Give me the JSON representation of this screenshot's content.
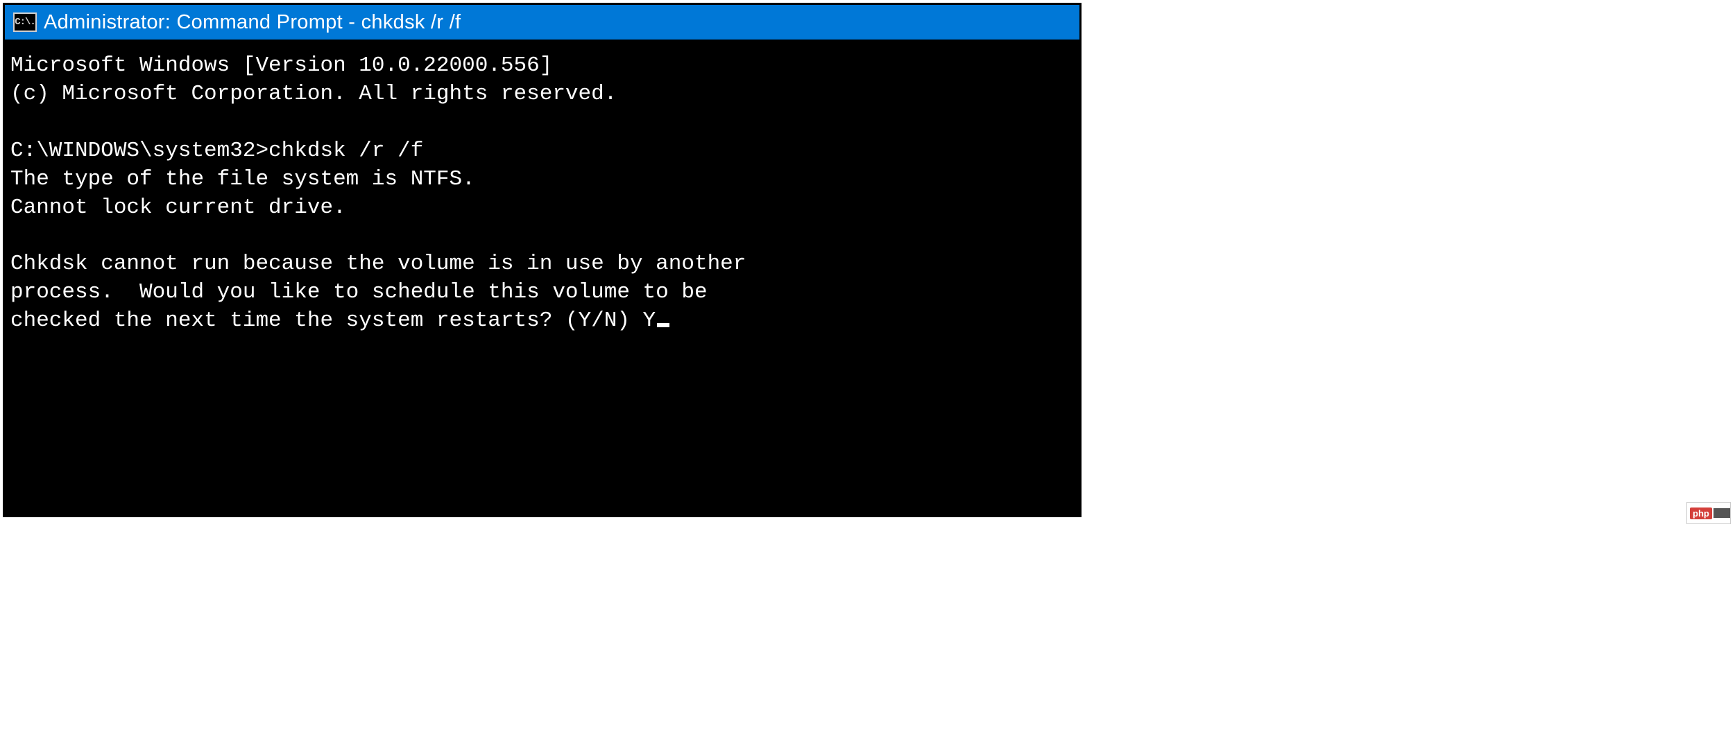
{
  "window": {
    "title": "Administrator: Command Prompt - chkdsk  /r /f",
    "icon_text": "C:\\."
  },
  "terminal": {
    "lines": [
      "Microsoft Windows [Version 10.0.22000.556]",
      "(c) Microsoft Corporation. All rights reserved.",
      "",
      "C:\\WINDOWS\\system32>chkdsk /r /f",
      "The type of the file system is NTFS.",
      "Cannot lock current drive.",
      "",
      "Chkdsk cannot run because the volume is in use by another",
      "process.  Would you like to schedule this volume to be",
      "checked the next time the system restarts? (Y/N) Y"
    ],
    "prompt": "C:\\WINDOWS\\system32>",
    "command": "chkdsk /r /f",
    "user_input": "Y"
  },
  "watermark": {
    "text": "php"
  }
}
